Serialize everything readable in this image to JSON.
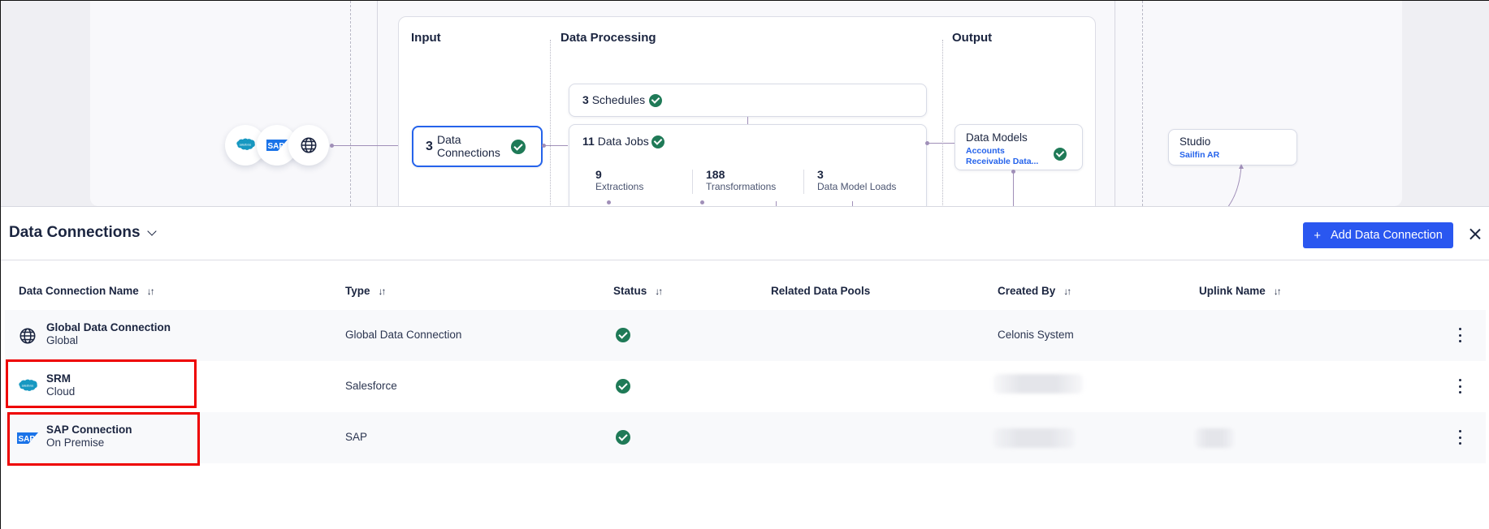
{
  "pipeline": {
    "sections": {
      "input": "Input",
      "processing": "Data Processing",
      "output": "Output"
    },
    "sources": [
      {
        "icon": "salesforce-icon"
      },
      {
        "icon": "sap-icon"
      },
      {
        "icon": "globe-icon"
      }
    ],
    "data_connections": {
      "count": "3",
      "label_line1": "Data",
      "label_line2": "Connections",
      "status": "success"
    },
    "schedules": {
      "count": "3",
      "label": "Schedules",
      "status": "success"
    },
    "data_jobs": {
      "count": "11",
      "label": "Data Jobs",
      "status": "success",
      "stats": [
        {
          "value": "9",
          "label": "Extractions"
        },
        {
          "value": "188",
          "label": "Transformations"
        },
        {
          "value": "3",
          "label": "Data Model Loads"
        }
      ]
    },
    "data_models": {
      "label": "Data Models",
      "link_line1": "Accounts",
      "link_line2": "Receivable Data...",
      "status": "success"
    },
    "studio": {
      "label": "Studio",
      "link": "Sailfin AR"
    }
  },
  "panel": {
    "title": "Data Connections",
    "add_button": {
      "icon": "+",
      "label": "Add Data Connection"
    },
    "columns": [
      {
        "label": "Data Connection Name",
        "sortable": true
      },
      {
        "label": "Type",
        "sortable": true
      },
      {
        "label": "Status",
        "sortable": true
      },
      {
        "label": "Related Data Pools",
        "sortable": false
      },
      {
        "label": "Created By",
        "sortable": true
      },
      {
        "label": "Uplink Name",
        "sortable": true
      }
    ],
    "sort_glyph": "↓↑",
    "rows": [
      {
        "icon": "globe-icon",
        "name": "Global Data Connection",
        "subtitle": "Global",
        "type": "Global Data Connection",
        "status": "success",
        "related_data_pools": "",
        "created_by": "Celonis System",
        "created_by_blurred": false,
        "uplink_name": "",
        "uplink_blurred": false,
        "highlighted": false
      },
      {
        "icon": "salesforce-icon",
        "name": "SRM",
        "subtitle": "Cloud",
        "type": "Salesforce",
        "status": "success",
        "related_data_pools": "",
        "created_by": "",
        "created_by_blurred": true,
        "uplink_name": "",
        "uplink_blurred": false,
        "highlighted": true
      },
      {
        "icon": "sap-icon",
        "name": "SAP Connection",
        "subtitle": "On Premise",
        "type": "SAP",
        "status": "success",
        "related_data_pools": "",
        "created_by": "",
        "created_by_blurred": true,
        "uplink_name": "",
        "uplink_blurred": true,
        "highlighted": true
      }
    ]
  },
  "colors": {
    "accent": "#2a57f0",
    "success": "#1f7a57",
    "link": "#2563eb",
    "highlight": "#ee0000",
    "connector": "#a08fb8"
  }
}
